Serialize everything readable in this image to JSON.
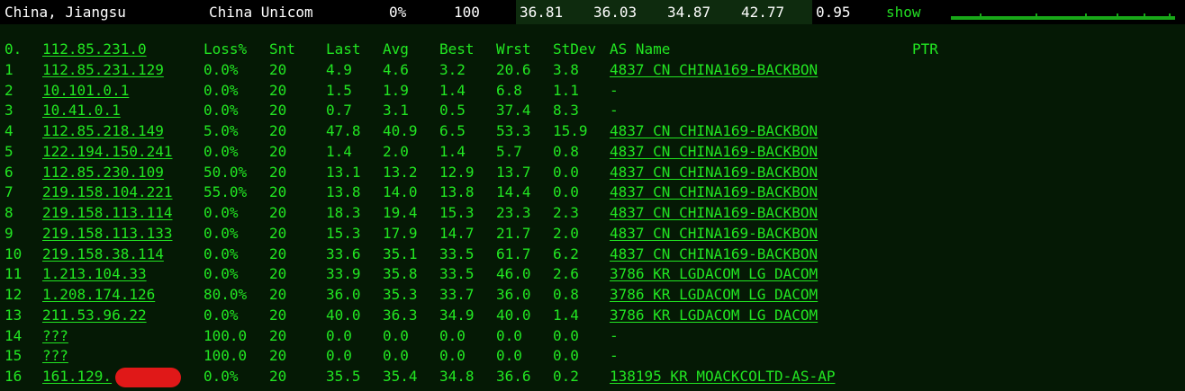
{
  "header": {
    "location": "China, Jiangsu",
    "isp": "China Unicom",
    "loss": "0%",
    "sent": "100",
    "last": "36.81",
    "avg": "36.03",
    "best": "34.87",
    "worst": "42.77",
    "stdev": "0.95",
    "show_label": "show"
  },
  "table": {
    "headers": {
      "hop": "0.",
      "host": "112.85.231.0",
      "loss": "Loss%",
      "snt": "Snt",
      "last": "Last",
      "avg": "Avg",
      "best": "Best",
      "wrst": "Wrst",
      "stdev": "StDev",
      "asname": "AS Name",
      "ptr": "PTR"
    },
    "rows": [
      {
        "hop": "1",
        "host": "112.85.231.129",
        "loss": "0.0%",
        "snt": "20",
        "last": "4.9",
        "avg": "4.6",
        "best": "3.2",
        "wrst": "20.6",
        "stdev": "3.8",
        "asname": "4837  CN CHINA169-BACKBON"
      },
      {
        "hop": "2",
        "host": "10.101.0.1",
        "loss": "0.0%",
        "snt": "20",
        "last": "1.5",
        "avg": "1.9",
        "best": "1.4",
        "wrst": "6.8",
        "stdev": "1.1",
        "asname": "-"
      },
      {
        "hop": "3",
        "host": "10.41.0.1",
        "loss": "0.0%",
        "snt": "20",
        "last": "0.7",
        "avg": "3.1",
        "best": "0.5",
        "wrst": "37.4",
        "stdev": "8.3",
        "asname": "-"
      },
      {
        "hop": "4",
        "host": "112.85.218.149",
        "loss": "5.0%",
        "snt": "20",
        "last": "47.8",
        "avg": "40.9",
        "best": "6.5",
        "wrst": "53.3",
        "stdev": "15.9",
        "asname": "4837  CN CHINA169-BACKBON"
      },
      {
        "hop": "5",
        "host": "122.194.150.241",
        "loss": "0.0%",
        "snt": "20",
        "last": "1.4",
        "avg": "2.0",
        "best": "1.4",
        "wrst": "5.7",
        "stdev": "0.8",
        "asname": "4837  CN CHINA169-BACKBON"
      },
      {
        "hop": "6",
        "host": "112.85.230.109",
        "loss": "50.0%",
        "snt": "20",
        "last": "13.1",
        "avg": "13.2",
        "best": "12.9",
        "wrst": "13.7",
        "stdev": "0.0",
        "asname": "4837  CN CHINA169-BACKBON"
      },
      {
        "hop": "7",
        "host": "219.158.104.221",
        "loss": "55.0%",
        "snt": "20",
        "last": "13.8",
        "avg": "14.0",
        "best": "13.8",
        "wrst": "14.4",
        "stdev": "0.0",
        "asname": "4837  CN CHINA169-BACKBON"
      },
      {
        "hop": "8",
        "host": "219.158.113.114",
        "loss": "0.0%",
        "snt": "20",
        "last": "18.3",
        "avg": "19.4",
        "best": "15.3",
        "wrst": "23.3",
        "stdev": "2.3",
        "asname": "4837  CN CHINA169-BACKBON"
      },
      {
        "hop": "9",
        "host": "219.158.113.133",
        "loss": "0.0%",
        "snt": "20",
        "last": "15.3",
        "avg": "17.9",
        "best": "14.7",
        "wrst": "21.7",
        "stdev": "2.0",
        "asname": "4837  CN CHINA169-BACKBON"
      },
      {
        "hop": "10",
        "host": "219.158.38.114",
        "loss": "0.0%",
        "snt": "20",
        "last": "33.6",
        "avg": "35.1",
        "best": "33.5",
        "wrst": "61.7",
        "stdev": "6.2",
        "asname": "4837  CN CHINA169-BACKBON"
      },
      {
        "hop": "11",
        "host": "1.213.104.33",
        "loss": "0.0%",
        "snt": "20",
        "last": "33.9",
        "avg": "35.8",
        "best": "33.5",
        "wrst": "46.0",
        "stdev": "2.6",
        "asname": "3786  KR LGDACOM LG DACOM"
      },
      {
        "hop": "12",
        "host": "1.208.174.126",
        "loss": "80.0%",
        "snt": "20",
        "last": "36.0",
        "avg": "35.3",
        "best": "33.7",
        "wrst": "36.0",
        "stdev": "0.8",
        "asname": "3786  KR LGDACOM LG DACOM"
      },
      {
        "hop": "13",
        "host": "211.53.96.22",
        "loss": "0.0%",
        "snt": "20",
        "last": "40.0",
        "avg": "36.3",
        "best": "34.9",
        "wrst": "40.0",
        "stdev": "1.4",
        "asname": "3786  KR LGDACOM LG DACOM"
      },
      {
        "hop": "14",
        "host": "???",
        "loss": "100.0",
        "snt": "20",
        "last": "0.0",
        "avg": "0.0",
        "best": "0.0",
        "wrst": "0.0",
        "stdev": "0.0",
        "asname": "-"
      },
      {
        "hop": "15",
        "host": "???",
        "loss": "100.0",
        "snt": "20",
        "last": "0.0",
        "avg": "0.0",
        "best": "0.0",
        "wrst": "0.0",
        "stdev": "0.0",
        "asname": "-"
      },
      {
        "hop": "16",
        "host": "161.129.",
        "loss": "0.0%",
        "snt": "20",
        "last": "35.5",
        "avg": "35.4",
        "best": "34.8",
        "wrst": "36.6",
        "stdev": "0.2",
        "asname": "138195 KR MOACKCOLTD-AS-AP"
      }
    ]
  },
  "colors": {
    "background": "#051905",
    "text_green": "#22e622",
    "header_bg": "#000000",
    "header_latency_bg": "#0e2b0e",
    "redaction": "#e01818"
  }
}
